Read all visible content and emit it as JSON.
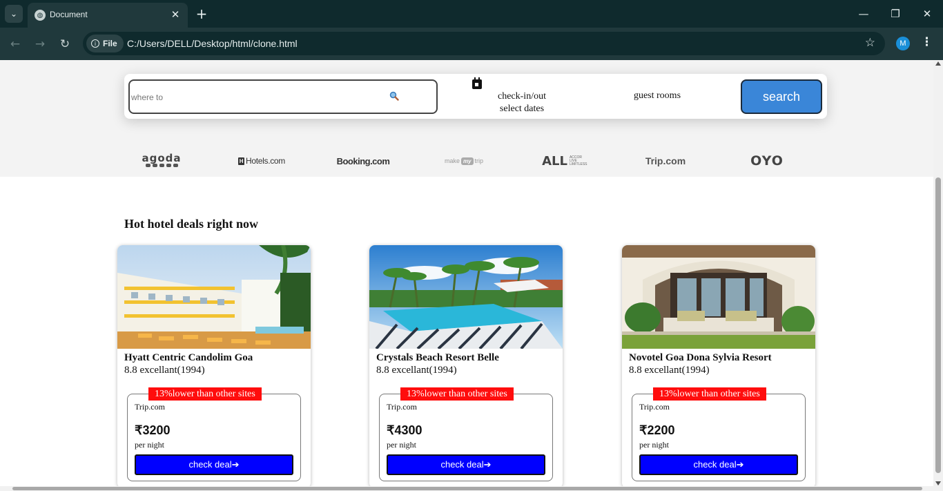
{
  "browser": {
    "tab_title": "Document",
    "site_chip": "File",
    "url": "C:/Users/DELL/Desktop/html/clone.html",
    "profile_initial": "M"
  },
  "search": {
    "where_placeholder": "where to",
    "dates_line1": "check-in/out",
    "dates_line2": "select dates",
    "guests_label": "guest rooms",
    "button_label": "search"
  },
  "partners": [
    {
      "name": "agoda"
    },
    {
      "name": "Hotels.com"
    },
    {
      "name": "Booking.com"
    },
    {
      "name_left": "make",
      "name_mid": "my",
      "name_right": "trip"
    },
    {
      "name": "ALL",
      "sub": "ACCOR LIVE LIMITLESS"
    },
    {
      "name": "Trip.com"
    },
    {
      "name": "OYO"
    }
  ],
  "deals": {
    "heading": "Hot hotel deals right now",
    "cards": [
      {
        "name": "Hyatt Centric Candolim Goa",
        "rating": "8.8 excellant(1994)",
        "badge": "13%lower than other sites",
        "site": "Trip.com",
        "price": "₹3200",
        "per": "per night",
        "button": "check deal➔"
      },
      {
        "name": "Crystals Beach Resort Belle",
        "rating": "8.8 excellant(1994)",
        "badge": "13%lower than other sites",
        "site": "Trip.com",
        "price": "₹4300",
        "per": "per night",
        "button": "check deal➔"
      },
      {
        "name": "Novotel Goa Dona Sylvia Resort",
        "rating": "8.8 excellant(1994)",
        "badge": "13%lower than other sites",
        "site": "Trip.com",
        "price": "₹2200",
        "per": "per night",
        "button": "check deal➔"
      }
    ]
  },
  "colors": {
    "search_button": "#3a86d8",
    "deal_badge": "#ff0d0d",
    "deal_button": "#0000ff",
    "chrome_dark": "#0f2a2d"
  }
}
